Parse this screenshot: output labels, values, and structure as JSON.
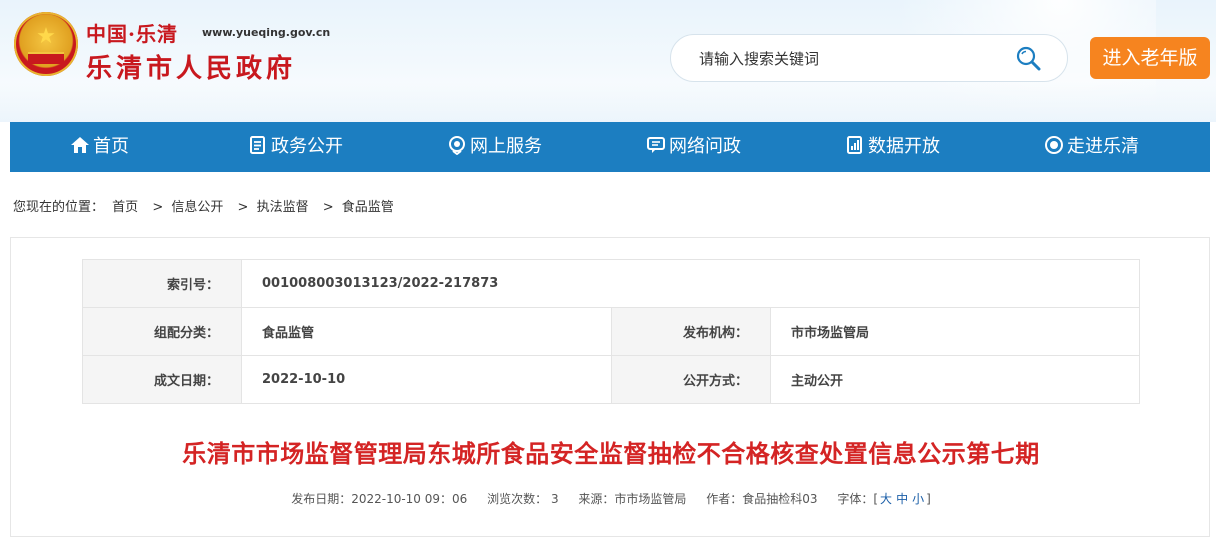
{
  "header": {
    "brand_top": "中国·乐清",
    "brand_url": "www.yueqing.gov.cn",
    "brand_name": "乐清市人民政府",
    "search_placeholder": "请输入搜索关键词",
    "elder_button": "进入老年版"
  },
  "nav": [
    {
      "label": "首页",
      "icon": "home-icon"
    },
    {
      "label": "政务公开",
      "icon": "document-icon"
    },
    {
      "label": "网上服务",
      "icon": "service-icon"
    },
    {
      "label": "网络问政",
      "icon": "chat-icon"
    },
    {
      "label": "数据开放",
      "icon": "data-icon"
    },
    {
      "label": "走进乐清",
      "icon": "eye-icon"
    }
  ],
  "breadcrumb": {
    "prefix": "您现在的位置：",
    "items": [
      "首页",
      "信息公开",
      "执法监督",
      "食品监管"
    ],
    "separator": ">"
  },
  "meta": {
    "index_label": "索引号：",
    "index_value": "001008003013123/2022-217873",
    "category_label": "组配分类：",
    "category_value": "食品监管",
    "issuer_label": "发布机构：",
    "issuer_value": "市市场监管局",
    "date_label": "成文日期：",
    "date_value": "2022-10-10",
    "mode_label": "公开方式：",
    "mode_value": "主动公开"
  },
  "article": {
    "title": "乐清市市场监督管理局东城所食品安全监督抽检不合格核查处置信息公示第七期",
    "publish": "发布日期：2022-10-10 09：06",
    "views": "浏览次数： 3",
    "source": "来源：市市场监管局",
    "author": "作者：食品抽检科03",
    "font_label": "字体：[",
    "font_large": "大",
    "font_medium": "中",
    "font_small": "小",
    "font_end": "]"
  },
  "colors": {
    "nav_bg": "#1c7ec1",
    "title_red": "#d42424",
    "brand_red": "#c8181e",
    "elder_orange": "#f6841f"
  }
}
